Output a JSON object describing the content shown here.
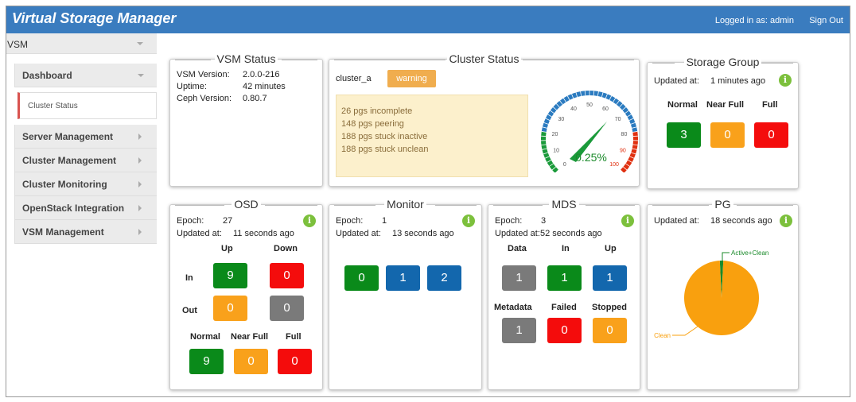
{
  "app": {
    "title": "Virtual Storage Manager"
  },
  "header": {
    "logged_in": "Logged in as: admin",
    "sign_out": "Sign Out"
  },
  "sidebar": {
    "root": "VSM",
    "items": [
      {
        "label": "Dashboard"
      },
      {
        "label": "Cluster Status"
      },
      {
        "label": "Server Management"
      },
      {
        "label": "Cluster Management"
      },
      {
        "label": "Cluster Monitoring"
      },
      {
        "label": "OpenStack Integration"
      },
      {
        "label": "VSM Management"
      }
    ]
  },
  "vsm_status": {
    "title": "VSM Status",
    "version_label": "VSM Version:",
    "version": "2.0.0-216",
    "uptime_label": "Uptime:",
    "uptime": "42 minutes",
    "ceph_label": "Ceph Version:",
    "ceph": "0.80.7"
  },
  "cluster_status": {
    "title": "Cluster Status",
    "cluster_name": "cluster_a",
    "health": "warning",
    "messages": [
      "26 pgs incomplete",
      "148 pgs peering",
      "188 pgs stuck inactive",
      "188 pgs stuck unclean"
    ],
    "gauge": {
      "value_text": "0.25%",
      "value": 0.25,
      "ticks": [
        "0",
        "10",
        "20",
        "30",
        "40",
        "50",
        "60",
        "70",
        "80",
        "90",
        "100"
      ],
      "colors": {
        "green": "#1a9a3a",
        "blue": "#2b7bc0",
        "red": "#e03010"
      }
    }
  },
  "storage_group": {
    "title": "Storage Group",
    "updated_label": "Updated at:",
    "updated": "1 minutes ago",
    "headers": [
      "Normal",
      "Near Full",
      "Full"
    ],
    "values": [
      "3",
      "0",
      "0"
    ]
  },
  "osd": {
    "title": "OSD",
    "epoch_label": "Epoch:",
    "epoch": "27",
    "updated_label": "Updated at:",
    "updated": "11 seconds ago",
    "col_up": "Up",
    "col_down": "Down",
    "row_in": "In",
    "row_out": "Out",
    "in_up": "9",
    "in_down": "0",
    "out_up": "0",
    "out_down": "0",
    "cap_headers": [
      "Normal",
      "Near Full",
      "Full"
    ],
    "cap_values": [
      "9",
      "0",
      "0"
    ]
  },
  "monitor": {
    "title": "Monitor",
    "epoch_label": "Epoch:",
    "epoch": "1",
    "updated_label": "Updated at:",
    "updated": "13 seconds ago",
    "values": [
      "0",
      "1",
      "2"
    ]
  },
  "mds": {
    "title": "MDS",
    "epoch_label": "Epoch:",
    "epoch": "3",
    "updated_label": "Updated at:",
    "updated": "52 seconds ago",
    "headers1": [
      "Data",
      "In",
      "Up"
    ],
    "values1": [
      "1",
      "1",
      "1"
    ],
    "headers2": [
      "Metadata",
      "Failed",
      "Stopped"
    ],
    "values2": [
      "1",
      "0",
      "0"
    ]
  },
  "pg": {
    "title": "PG",
    "updated_label": "Updated at:",
    "updated": "18 seconds ago",
    "chart_data": {
      "type": "pie",
      "slices": [
        {
          "label": "Active+Clean",
          "value": 1.5,
          "color": "#1a8a2a"
        },
        {
          "label": "Clean",
          "value": 98.5,
          "color": "#f9a00e"
        }
      ]
    }
  },
  "info_glyph": "i"
}
